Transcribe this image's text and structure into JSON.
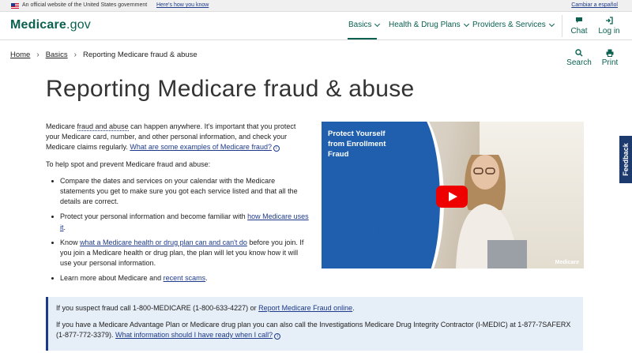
{
  "gov_banner": {
    "text": "An official website of the United States government",
    "link": "Here's how you know",
    "espanol": "Cambiar a español"
  },
  "header": {
    "logo_main": "Medicare",
    "logo_suffix": ".gov",
    "nav": [
      {
        "label": "Basics",
        "active": true
      },
      {
        "label": "Health & Drug Plans"
      },
      {
        "label": "Providers & Services"
      }
    ],
    "chat": "Chat",
    "login": "Log in"
  },
  "breadcrumb": [
    "Home",
    "Basics",
    "Reporting Medicare fraud & abuse"
  ],
  "utility": {
    "search": "Search",
    "print": "Print"
  },
  "page_title": "Reporting Medicare fraud & abuse",
  "intro": {
    "pre": "Medicare ",
    "term": "fraud and abuse",
    "post": " can happen anywhere. It's important that you protect your Medicare card, number, and other personal information, and check your Medicare claims regularly. ",
    "link": "What are some examples of Medicare fraud?"
  },
  "lead": "To help spot and prevent Medicare fraud and abuse:",
  "tips": [
    {
      "pre": "Compare the dates and services on your calendar with the Medicare statements you get to make sure you got each service listed and that all the details are correct."
    },
    {
      "pre": "Protect your personal information and become familiar with ",
      "link": "how Medicare uses it",
      "post": "."
    },
    {
      "pre": "Know ",
      "link": "what a Medicare health or drug plan can and can't do",
      "post": " before you join. If you join a Medicare health or drug plan, the plan will let you know how it will use your personal information."
    },
    {
      "pre": "Learn more about Medicare and ",
      "link": "recent scams",
      "post": "."
    }
  ],
  "video": {
    "title": "Protect Yourself from Enrollment Fraud",
    "brand": "Medicare"
  },
  "callout": {
    "line1_pre": "If you suspect fraud call 1-800-MEDICARE (1-800-633-4227) or ",
    "line1_link": "Report Medicare Fraud online",
    "line1_post": ".",
    "line2_pre": "If you have a Medicare Advantage Plan or Medicare drug plan you can also call the Investigations Medicare Drug Integrity Contractor (I-MEDIC) at 1-877-7SAFERX (1-877-772-3379). ",
    "line2_link": "What information should I have ready when I call?"
  },
  "feedback": "Feedback",
  "colors": {
    "brand_green": "#0b6150",
    "link_blue": "#1d3a8a",
    "callout_bg": "#e6eef7",
    "video_panel": "#1f5fad",
    "youtube_red": "#ee0000"
  }
}
